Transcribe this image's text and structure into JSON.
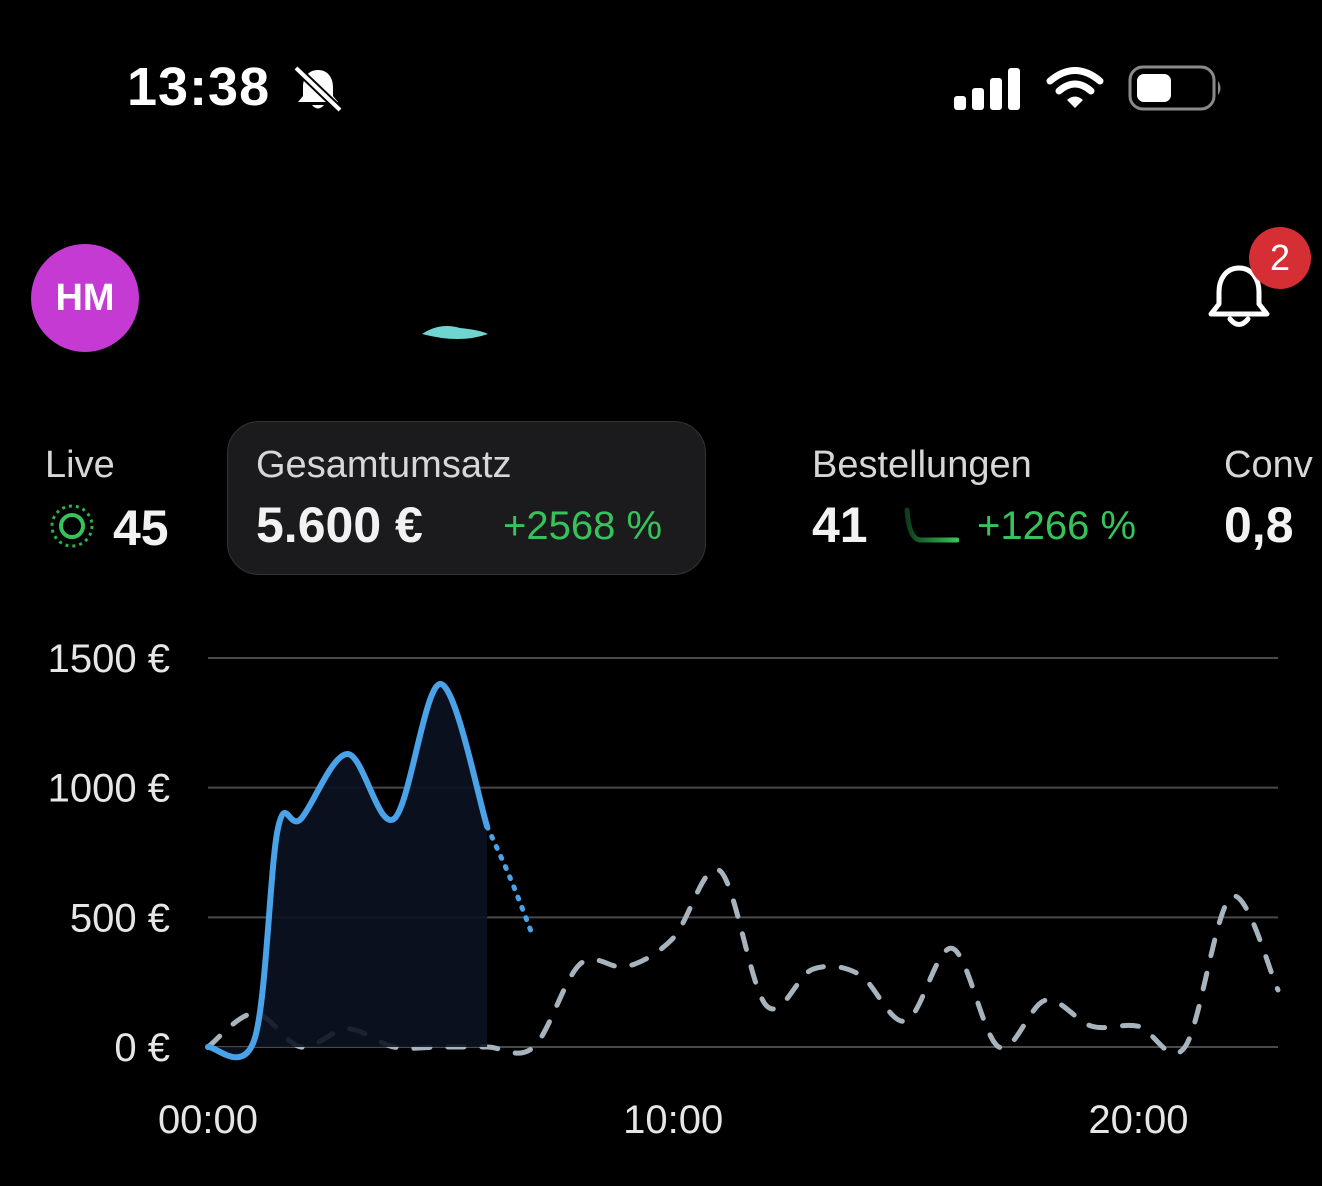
{
  "status_bar": {
    "time": "13:38",
    "icons": [
      "bell-slash-icon",
      "signal-icon",
      "wifi-icon",
      "battery-icon"
    ]
  },
  "header": {
    "avatar_initials": "HM",
    "avatar_color": "#c53ad3",
    "notification_count": "2",
    "badge_color": "#d62e35"
  },
  "metrics": {
    "live": {
      "label": "Live",
      "value": "45"
    },
    "total_sales": {
      "label": "Gesamtumsatz",
      "value": "5.600 €",
      "change": "+2568 %"
    },
    "orders": {
      "label": "Bestellungen",
      "value": "41",
      "change": "+1266 %"
    },
    "conversion": {
      "label": "Conv",
      "value": "0,8"
    },
    "positive_color": "#37c35b"
  },
  "chart_data": {
    "type": "line",
    "x_unit": "hour",
    "x_range": [
      0,
      23
    ],
    "x_ticks": [
      "00:00",
      "10:00",
      "20:00"
    ],
    "ylim": [
      0,
      1500
    ],
    "y_ticks": [
      "0 €",
      "500 €",
      "1000 €",
      "1500 €"
    ],
    "grid": true,
    "series": [
      {
        "style": "solid-then-dotted",
        "color": "#4aa3e8",
        "x": [
          0,
          1,
          1.5,
          2,
          3,
          4,
          5,
          6,
          6.5,
          7
        ],
        "y": [
          0,
          30,
          840,
          880,
          1130,
          880,
          1400,
          850,
          650,
          420
        ],
        "solid_until_x": 6
      },
      {
        "style": "dashed",
        "color": "#a8b4bd",
        "x": [
          0,
          1,
          2,
          3,
          4,
          5,
          6,
          7,
          8,
          9,
          10,
          11,
          12,
          13,
          14,
          15,
          16,
          17,
          18,
          19,
          20,
          21,
          22,
          23
        ],
        "y": [
          0,
          130,
          0,
          70,
          0,
          0,
          0,
          0,
          320,
          310,
          420,
          680,
          160,
          300,
          280,
          100,
          380,
          0,
          180,
          80,
          80,
          0,
          580,
          220
        ]
      }
    ]
  }
}
